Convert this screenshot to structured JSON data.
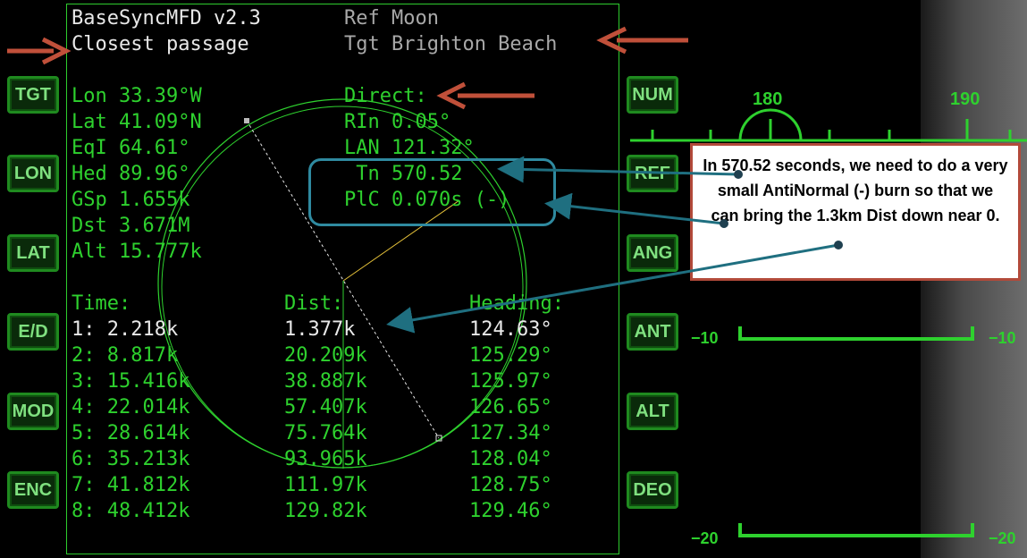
{
  "header": {
    "app_title": "BaseSyncMFD v2.3",
    "ref": "Ref Moon",
    "mode": "Closest passage",
    "target": "Tgt Brighton Beach"
  },
  "left_stats": [
    "Lon 33.39°W",
    "Lat 41.09°N",
    "EqI 64.61°",
    "Hed 89.96°",
    "GSp 1.655k",
    "Dst 3.671M",
    "Alt 15.777k"
  ],
  "right_stats": [
    "Direct:",
    "RIn 0.05°",
    "LAN 121.32°",
    " Tn 570.52",
    "PlC 0.070s (-)"
  ],
  "table": {
    "headers": [
      "Time:",
      "Dist:",
      "Heading:"
    ],
    "rows": [
      [
        "1: 2.218k",
        "1.377k",
        "124.63°"
      ],
      [
        "2: 8.817k",
        "20.209k",
        "125.29°"
      ],
      [
        "3: 15.416k",
        "38.887k",
        "125.97°"
      ],
      [
        "4: 22.014k",
        "57.407k",
        "126.65°"
      ],
      [
        "5: 28.614k",
        "75.764k",
        "127.34°"
      ],
      [
        "6: 35.213k",
        "93.965k",
        "128.04°"
      ],
      [
        "7: 41.812k",
        "111.97k",
        "128.75°"
      ],
      [
        "8: 48.412k",
        "129.82k",
        "129.46°"
      ]
    ]
  },
  "left_buttons": [
    "TGT",
    "LON",
    "LAT",
    "E/D",
    "MOD",
    "ENC"
  ],
  "right_buttons": [
    "NUM",
    "REF",
    "ANG",
    "ANT",
    "ALT",
    "DEO"
  ],
  "hud": {
    "heading_ticks": [
      "180",
      "190"
    ],
    "pitch_labels": [
      "−10",
      "−10",
      "−20",
      "−20"
    ]
  },
  "callout": {
    "text": "In 570.52 seconds, we need to do a very small AntiNormal (-) burn so that we can bring the 1.3km Dist down near 0."
  },
  "colors": {
    "mfd_green": "#2ed12e",
    "arrow_red": "#c0503a",
    "callout_border": "#b24a3a",
    "highlight_teal": "#2f8aa0"
  }
}
